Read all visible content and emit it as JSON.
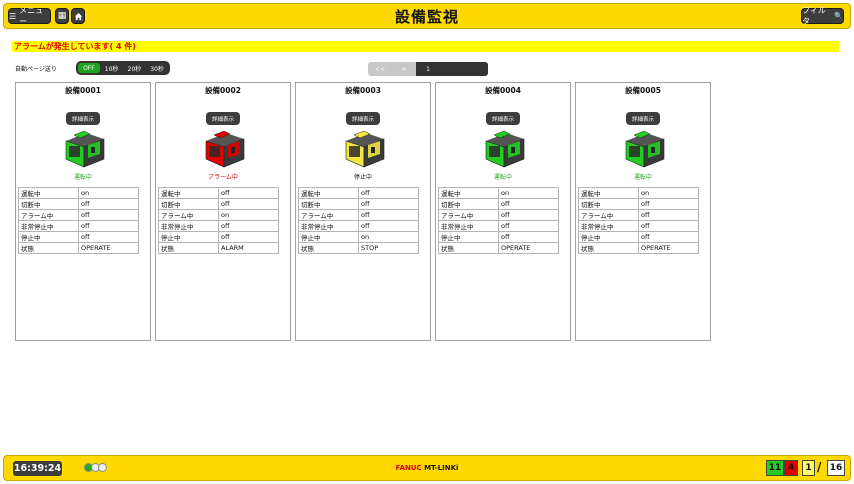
{
  "header": {
    "menu_label": "メニュー",
    "title": "設備監視",
    "filter_label": "フィルタ"
  },
  "alarm_banner": "アラームが発生しています( 4 件)",
  "auto_page": {
    "label": "自動ページ送り",
    "options": [
      "OFF",
      "10秒",
      "20秒",
      "30秒"
    ],
    "selected": "OFF"
  },
  "pager": {
    "first": "<<",
    "prev": "<",
    "current": "1",
    "next": ">",
    "last": ">>"
  },
  "colors": {
    "header_bg": "#ffd900",
    "running": "#22cc22",
    "alarm": "#e00000",
    "stopped": "#f2e640",
    "idle": "#2f2f2f"
  },
  "machines": [
    {
      "name": "設備0001",
      "detail_label": "詳細表示",
      "state_label": "運転中",
      "state_color": "#22aa22",
      "body_color": "#22cc22",
      "rows": [
        [
          "運転中",
          "on"
        ],
        [
          "切断中",
          "off"
        ],
        [
          "アラーム中",
          "off"
        ],
        [
          "非常停止中",
          "off"
        ],
        [
          "停止中",
          "off"
        ],
        [
          "状態",
          "OPERATE"
        ]
      ]
    },
    {
      "name": "設備0002",
      "detail_label": "詳細表示",
      "state_label": "アラーム中",
      "state_color": "#e00000",
      "body_color": "#e00000",
      "rows": [
        [
          "運転中",
          "off"
        ],
        [
          "切断中",
          "off"
        ],
        [
          "アラーム中",
          "on"
        ],
        [
          "非常停止中",
          "off"
        ],
        [
          "停止中",
          "off"
        ],
        [
          "状態",
          "ALARM"
        ]
      ]
    },
    {
      "name": "設備0003",
      "detail_label": "詳細表示",
      "state_label": "停止中",
      "state_color": "#111111",
      "body_color": "#f2e640",
      "rows": [
        [
          "運転中",
          "off"
        ],
        [
          "切断中",
          "off"
        ],
        [
          "アラーム中",
          "off"
        ],
        [
          "非常停止中",
          "off"
        ],
        [
          "停止中",
          "on"
        ],
        [
          "状態",
          "STOP"
        ]
      ]
    },
    {
      "name": "設備0004",
      "detail_label": "詳細表示",
      "state_label": "運転中",
      "state_color": "#22aa22",
      "body_color": "#22cc22",
      "rows": [
        [
          "運転中",
          "on"
        ],
        [
          "切断中",
          "off"
        ],
        [
          "アラーム中",
          "off"
        ],
        [
          "非常停止中",
          "off"
        ],
        [
          "停止中",
          "off"
        ],
        [
          "状態",
          "OPERATE"
        ]
      ]
    },
    {
      "name": "設備0005",
      "detail_label": "詳細表示",
      "state_label": "運転中",
      "state_color": "#22aa22",
      "body_color": "#22cc22",
      "rows": [
        [
          "運転中",
          "on"
        ],
        [
          "切断中",
          "off"
        ],
        [
          "アラーム中",
          "off"
        ],
        [
          "非常停止中",
          "off"
        ],
        [
          "停止中",
          "off"
        ],
        [
          "状態",
          "OPERATE"
        ]
      ]
    }
  ],
  "footer": {
    "clock": "16:39:24",
    "brand_fanuc": "FANUC",
    "brand_product": "MT-LINKi",
    "count_running": "11",
    "count_alarm": "4",
    "count_stop": "1",
    "separator": "/",
    "count_total": "16"
  }
}
